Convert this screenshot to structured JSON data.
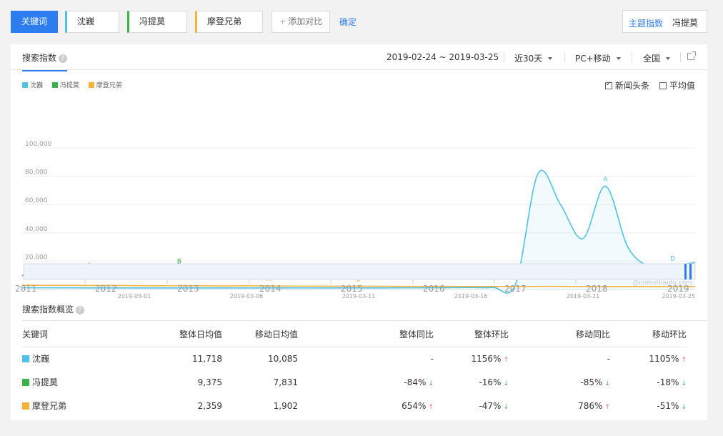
{
  "topbar": {
    "main_keyword_label": "关键词",
    "keywords": [
      "沈巍",
      "冯提莫",
      "摩登兄弟"
    ],
    "add_compare": "添加对比",
    "add_compare_icon": "plus-icon",
    "confirm": "确定",
    "theme_label": "主题指数",
    "theme_keyword": "冯提莫"
  },
  "panel": {
    "tab": "搜索指数",
    "date_range": "2019-02-24 ~ 2019-03-25",
    "period": "近30天",
    "device": "PC+移动",
    "region": "全国"
  },
  "legend": [
    {
      "name": "沈巍",
      "color": "#4ec1e6"
    },
    {
      "name": "冯提莫",
      "color": "#38b449"
    },
    {
      "name": "摩登兄弟",
      "color": "#f5b33c"
    }
  ],
  "options": {
    "news": "新闻头条",
    "news_checked": true,
    "average": "平均值",
    "average_checked": false
  },
  "chart_data": {
    "type": "line",
    "x_labels": [
      "2019-03-01",
      "2019-03-06",
      "2019-03-11",
      "2019-03-16",
      "2019-03-21",
      "2019-03-25"
    ],
    "y_ticks": [
      "100,000",
      "80,000",
      "60,000",
      "40,000",
      "20,000"
    ],
    "ylim": [
      0,
      100000
    ],
    "grid": true,
    "watermark": "@index.baidu.com",
    "series": [
      {
        "name": "沈巍",
        "color": "#4ec1e6",
        "values": [
          1200,
          1200,
          1200,
          1100,
          1100,
          1100,
          1100,
          1100,
          1100,
          1100,
          1100,
          1100,
          1100,
          1100,
          1100,
          1100,
          1100,
          1200,
          1200,
          1300,
          1400,
          1500,
          4000,
          82000,
          60000,
          36000,
          73000,
          30000,
          16000,
          17000,
          19000
        ]
      },
      {
        "name": "冯提莫",
        "color": "#38b449",
        "values": [
          10000,
          9000,
          10000,
          12000,
          10000,
          9000,
          9500,
          15000,
          12000,
          10000,
          10000,
          9500,
          10000,
          10000,
          10500,
          10000,
          9500,
          9500,
          9000,
          8800,
          8800,
          9000,
          10000,
          9500,
          8500,
          8500,
          9000,
          8500,
          9000,
          11000,
          10000
        ]
      },
      {
        "name": "摩登兄弟",
        "color": "#f5b33c",
        "values": [
          3000,
          2900,
          2900,
          2800,
          2800,
          2700,
          2600,
          2700,
          2600,
          2500,
          2600,
          2500,
          2400,
          2400,
          2300,
          2300,
          2300,
          2200,
          2200,
          2200,
          2100,
          2200,
          2100,
          2200,
          2200,
          2100,
          2100,
          2100,
          2100,
          2100,
          2200
        ]
      }
    ],
    "annotations": [
      {
        "label": "A",
        "series": "冯提莫",
        "index": 3
      },
      {
        "label": "B",
        "series": "冯提莫",
        "index": 7
      },
      {
        "label": "A",
        "series": "摩登兄弟",
        "index": 11
      },
      {
        "label": "B",
        "series": "摩登兄弟",
        "index": 15
      },
      {
        "label": "C",
        "series": "冯提莫",
        "index": 20
      },
      {
        "label": "A",
        "series": "沈巍",
        "index": 26
      },
      {
        "label": "D",
        "series": "沈巍",
        "index": 29
      }
    ],
    "timeline_years": [
      "2011",
      "2012",
      "2013",
      "2014",
      "2015",
      "2016",
      "2017",
      "2018",
      "2019"
    ]
  },
  "overview": {
    "title": "搜索指数概览",
    "headers": [
      "关键词",
      "整体日均值",
      "移动日均值",
      "整体同比",
      "整体环比",
      "移动同比",
      "移动环比"
    ],
    "rows": [
      {
        "keyword": "沈巍",
        "color": "#4ec1e6",
        "overall_avg": "11,718",
        "mobile_avg": "10,085",
        "overall_yoy": "-",
        "overall_yoy_dir": "",
        "overall_mom": "1156%",
        "overall_mom_dir": "up",
        "mobile_yoy": "-",
        "mobile_yoy_dir": "",
        "mobile_mom": "1105%",
        "mobile_mom_dir": "up"
      },
      {
        "keyword": "冯提莫",
        "color": "#38b449",
        "overall_avg": "9,375",
        "mobile_avg": "7,831",
        "overall_yoy": "-84%",
        "overall_yoy_dir": "down",
        "overall_mom": "-16%",
        "overall_mom_dir": "down",
        "mobile_yoy": "-85%",
        "mobile_yoy_dir": "down",
        "mobile_mom": "-18%",
        "mobile_mom_dir": "down"
      },
      {
        "keyword": "摩登兄弟",
        "color": "#f5b33c",
        "overall_avg": "2,359",
        "mobile_avg": "1,902",
        "overall_yoy": "654%",
        "overall_yoy_dir": "up",
        "overall_mom": "-47%",
        "overall_mom_dir": "down",
        "mobile_yoy": "786%",
        "mobile_yoy_dir": "up",
        "mobile_mom": "-51%",
        "mobile_mom_dir": "down"
      }
    ]
  }
}
